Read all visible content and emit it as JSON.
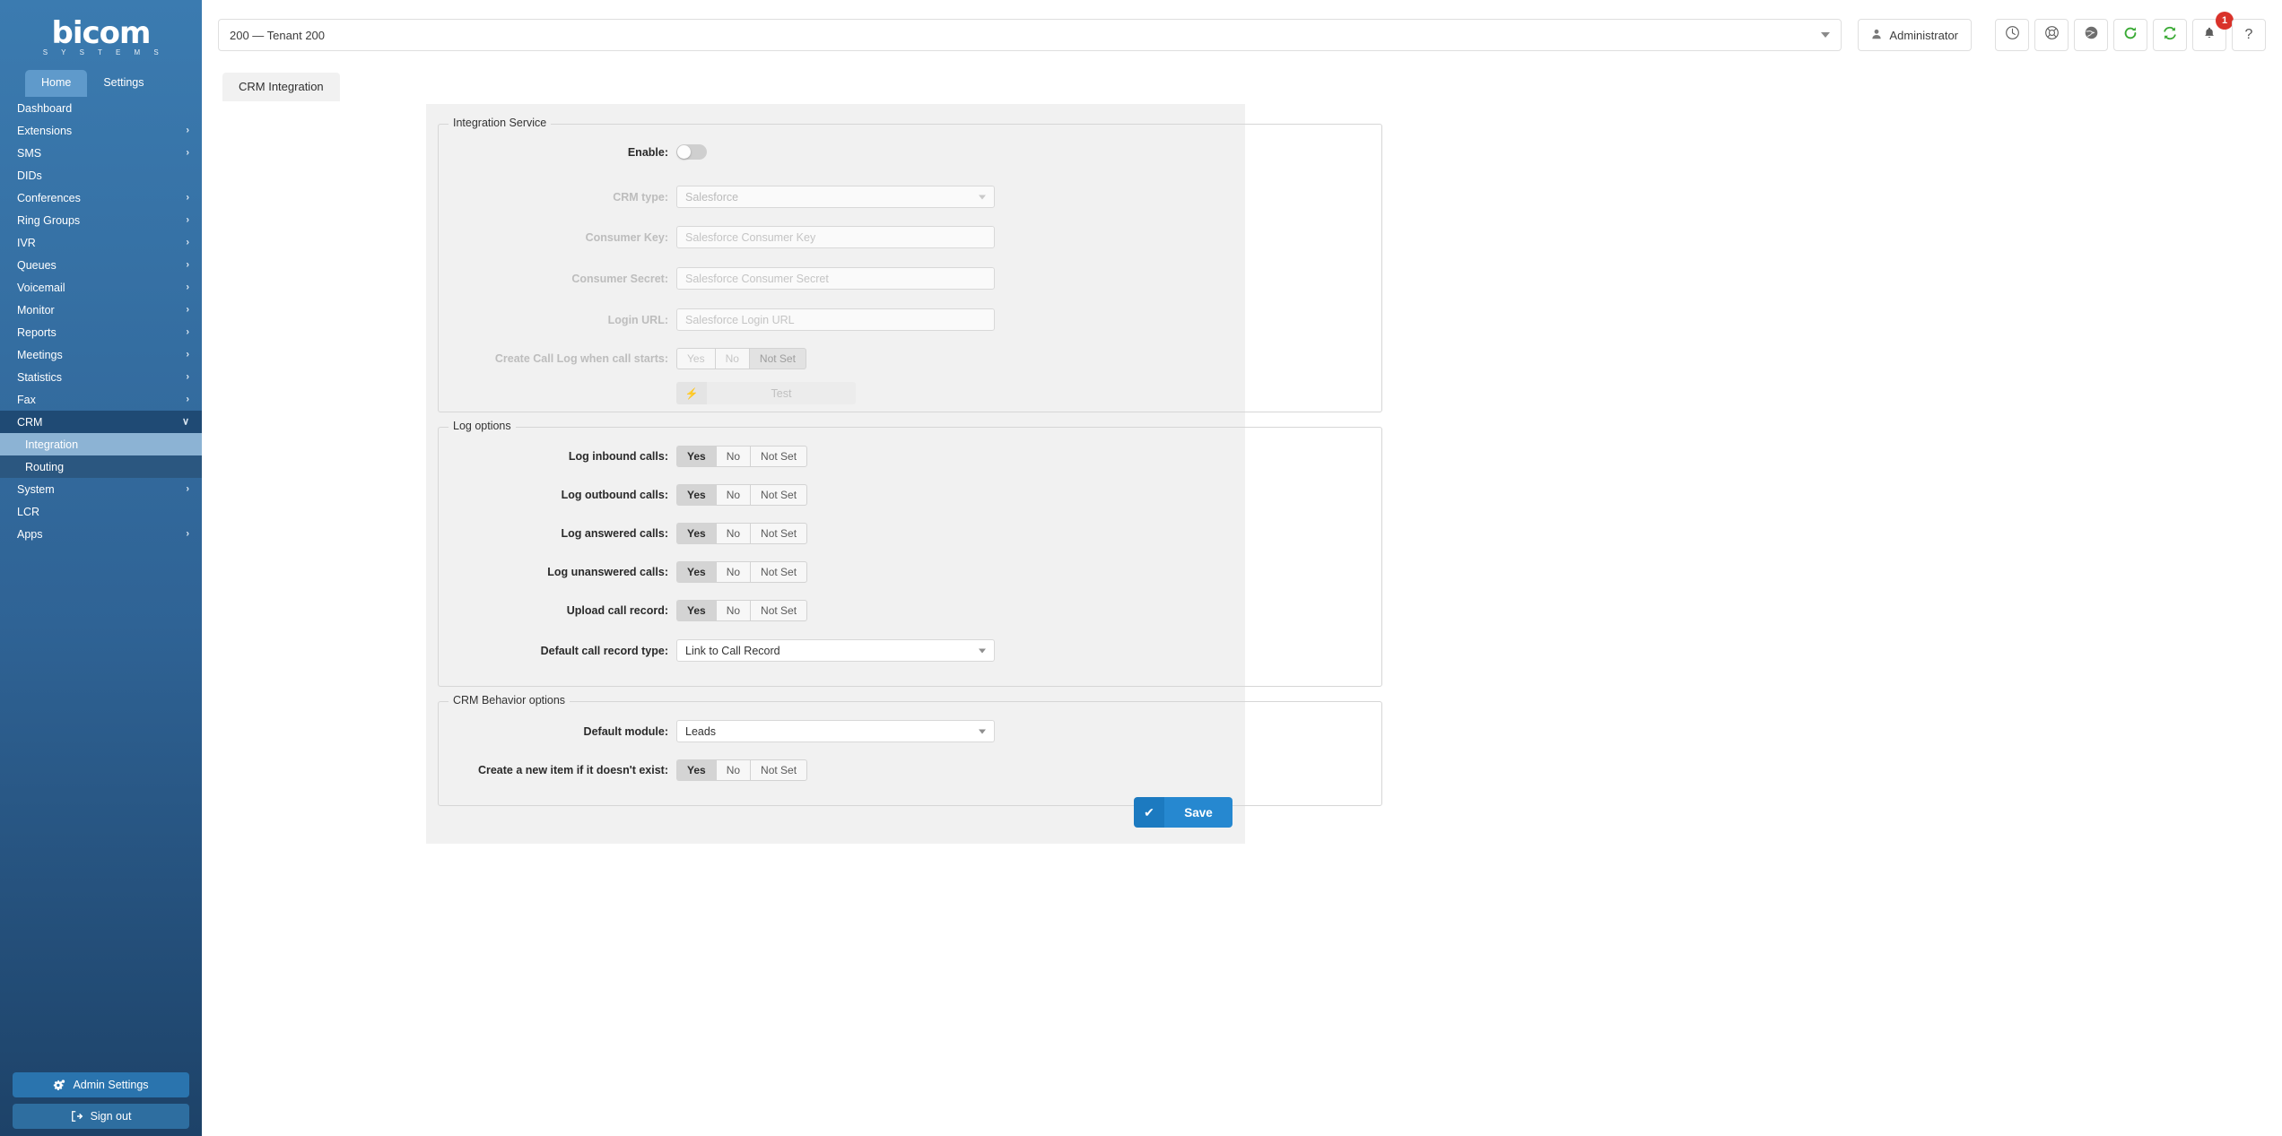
{
  "brand": {
    "name": "bicom",
    "tagline": "S Y S T E M S"
  },
  "nav_tabs": [
    {
      "label": "Home",
      "active": true
    },
    {
      "label": "Settings",
      "active": false
    }
  ],
  "sidebar": {
    "items": [
      {
        "label": "Dashboard",
        "chevron": ""
      },
      {
        "label": "Extensions",
        "chevron": "›"
      },
      {
        "label": "SMS",
        "chevron": "›"
      },
      {
        "label": "DIDs",
        "chevron": ""
      },
      {
        "label": "Conferences",
        "chevron": "›"
      },
      {
        "label": "Ring Groups",
        "chevron": "›"
      },
      {
        "label": "IVR",
        "chevron": "›"
      },
      {
        "label": "Queues",
        "chevron": "›"
      },
      {
        "label": "Voicemail",
        "chevron": "›"
      },
      {
        "label": "Monitor",
        "chevron": "›"
      },
      {
        "label": "Reports",
        "chevron": "›"
      },
      {
        "label": "Meetings",
        "chevron": "›"
      },
      {
        "label": "Statistics",
        "chevron": "›"
      },
      {
        "label": "Fax",
        "chevron": "›"
      },
      {
        "label": "CRM",
        "chevron": "∨",
        "expanded": true
      },
      {
        "label": "Integration",
        "chevron": "",
        "sub": true,
        "active": true
      },
      {
        "label": "Routing",
        "chevron": "",
        "sub": true
      },
      {
        "label": "System",
        "chevron": "›"
      },
      {
        "label": "LCR",
        "chevron": ""
      },
      {
        "label": "Apps",
        "chevron": "›"
      }
    ],
    "admin_settings_label": "Admin Settings",
    "sign_out_label": "Sign out"
  },
  "topbar": {
    "tenant_value": "200  —  Tenant 200",
    "admin_label": "Administrator",
    "icons": [
      {
        "name": "clock-icon"
      },
      {
        "name": "life-ring-icon"
      },
      {
        "name": "globe-icon"
      },
      {
        "name": "refresh-icon"
      },
      {
        "name": "sync-icon"
      },
      {
        "name": "bell-icon",
        "badge": "1"
      },
      {
        "name": "help-icon",
        "glyph": "?"
      }
    ],
    "badge_color": "#d9322a",
    "refresh_color": "#3aaa35"
  },
  "tab": {
    "label": "CRM Integration"
  },
  "integration_service": {
    "legend": "Integration Service",
    "enable_label": "Enable:",
    "enable_on": false,
    "crm_type_label": "CRM type:",
    "crm_type_value": "Salesforce",
    "consumer_key_label": "Consumer Key:",
    "consumer_key_placeholder": "Salesforce Consumer Key",
    "consumer_secret_label": "Consumer Secret:",
    "consumer_secret_placeholder": "Salesforce Consumer Secret",
    "login_url_label": "Login URL:",
    "login_url_placeholder": "Salesforce Login URL",
    "call_log_label": "Create Call Log when call starts:",
    "call_log_options": [
      "Yes",
      "No",
      "Not Set"
    ],
    "call_log_selected": "Not Set",
    "test_label": "Test",
    "test_icon": "⚡"
  },
  "log_options": {
    "legend": "Log options",
    "options": [
      "Yes",
      "No",
      "Not Set"
    ],
    "rows": [
      {
        "label": "Log inbound calls:",
        "selected": "Yes"
      },
      {
        "label": "Log outbound calls:",
        "selected": "Yes"
      },
      {
        "label": "Log answered calls:",
        "selected": "Yes"
      },
      {
        "label": "Log unanswered calls:",
        "selected": "Yes"
      },
      {
        "label": "Upload call record:",
        "selected": "Yes"
      }
    ],
    "record_type_label": "Default call record type:",
    "record_type_value": "Link to Call Record"
  },
  "behavior_options": {
    "legend": "CRM Behavior options",
    "module_label": "Default module:",
    "module_value": "Leads",
    "create_item_label": "Create a new item if it doesn't exist:",
    "options": [
      "Yes",
      "No",
      "Not Set"
    ],
    "create_item_selected": "Yes"
  },
  "save": {
    "label": "Save",
    "icon": "✔",
    "color": "#2688d0"
  }
}
